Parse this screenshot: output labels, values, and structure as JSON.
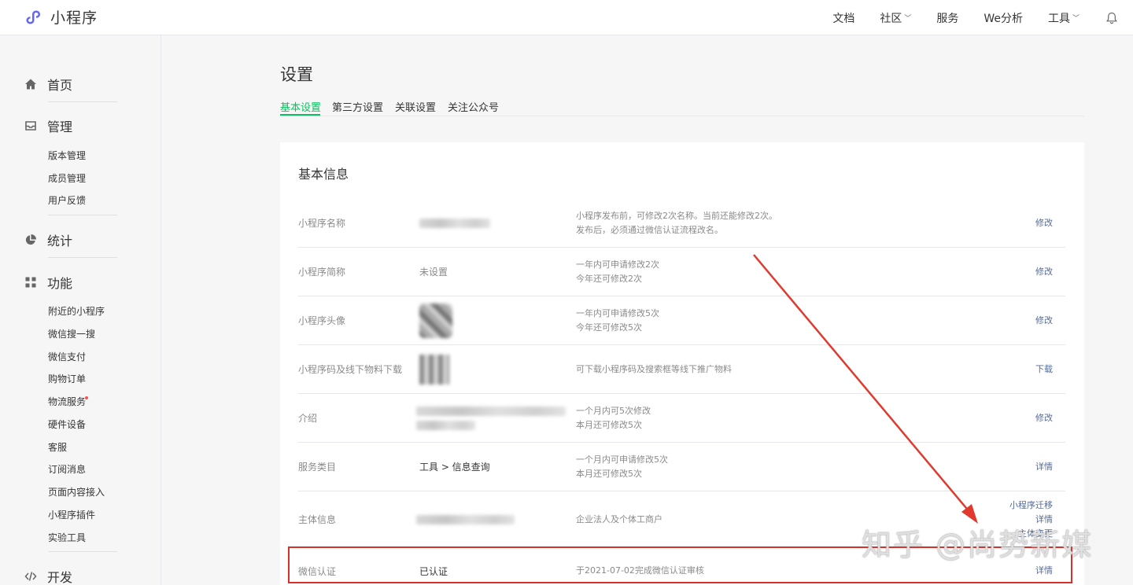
{
  "brand": {
    "name": "小程序"
  },
  "topnav": [
    {
      "label": "文档",
      "dropdown": false
    },
    {
      "label": "社区",
      "dropdown": true
    },
    {
      "label": "服务",
      "dropdown": false
    },
    {
      "label": "We分析",
      "dropdown": false
    },
    {
      "label": "工具",
      "dropdown": true
    }
  ],
  "sidebar": {
    "home": "首页",
    "manage": {
      "label": "管理",
      "items": [
        "版本管理",
        "成员管理",
        "用户反馈"
      ]
    },
    "stats": "统计",
    "features": {
      "label": "功能",
      "items": [
        "附近的小程序",
        "微信搜一搜",
        "微信支付",
        "购物订单",
        "物流服务",
        "硬件设备",
        "客服",
        "订阅消息",
        "页面内容接入",
        "小程序插件",
        "实验工具"
      ]
    },
    "dev": "开发"
  },
  "page": {
    "title": "设置",
    "tabs": [
      "基本设置",
      "第三方设置",
      "关联设置",
      "关注公众号"
    ],
    "active_tab": 0
  },
  "card": {
    "title": "基本信息",
    "rows": [
      {
        "label": "小程序名称",
        "value": "",
        "desc": [
          "小程序发布前，可修改2次名称。当前还能修改2次。",
          "发布后，必须通过微信认证流程改名。"
        ],
        "actions": [
          "修改"
        ]
      },
      {
        "label": "小程序简称",
        "value": "未设置",
        "desc": [
          "一年内可申请修改2次",
          "今年还可修改2次"
        ],
        "actions": [
          "修改"
        ]
      },
      {
        "label": "小程序头像",
        "value": "",
        "desc": [
          "一年内可申请修改5次",
          "今年还可修改5次"
        ],
        "actions": [
          "修改"
        ]
      },
      {
        "label": "小程序码及线下物料下载",
        "value": "",
        "desc": [
          "可下载小程序码及搜索框等线下推广物料"
        ],
        "actions": [
          "下载"
        ]
      },
      {
        "label": "介绍",
        "value": "",
        "desc": [
          "一个月内可5次修改",
          "本月还可修改5次"
        ],
        "actions": [
          "修改"
        ]
      },
      {
        "label": "服务类目",
        "value": "工具 > 信息查询",
        "desc": [
          "一个月内可申请修改5次",
          "本月还可修改5次"
        ],
        "actions": [
          "详情"
        ]
      },
      {
        "label": "主体信息",
        "value": "",
        "desc": [
          "企业法人及个体工商户"
        ],
        "actions": [
          "小程序迁移",
          "详情",
          "主体变更"
        ]
      },
      {
        "label": "微信认证",
        "value": "已认证",
        "desc": [
          "于2021-07-02完成微信认证审核"
        ],
        "actions": [
          "详情"
        ]
      }
    ]
  },
  "watermark": "知乎 @尚势新媒",
  "colors": {
    "accent": "#07c160",
    "link": "#576b95",
    "annotation": "#d9302a"
  }
}
